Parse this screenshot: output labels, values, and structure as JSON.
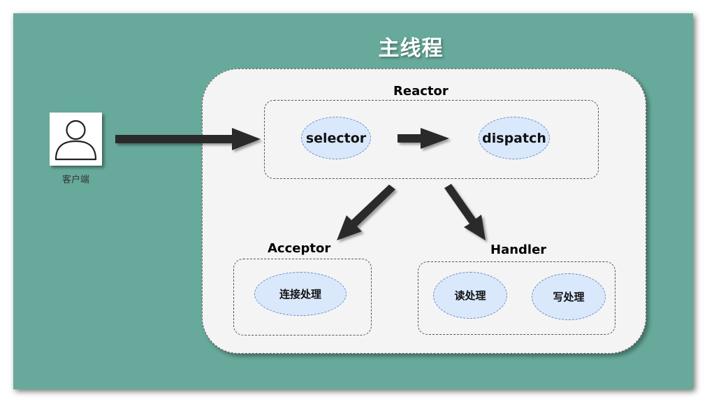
{
  "title": "主线程",
  "client": {
    "label": "客户端",
    "icon": "user-icon"
  },
  "reactor": {
    "label": "Reactor",
    "selector": "selector",
    "dispatch": "dispatch"
  },
  "acceptor": {
    "label": "Acceptor",
    "connect": "连接处理"
  },
  "handler": {
    "label": "Handler",
    "read": "读处理",
    "write": "写处理"
  },
  "colors": {
    "background": "#67a99b",
    "panel": "#f4f4f4",
    "node_fill": "#dae8fc",
    "node_border": "#6c8ebf",
    "arrow": "#2a2a2a"
  }
}
